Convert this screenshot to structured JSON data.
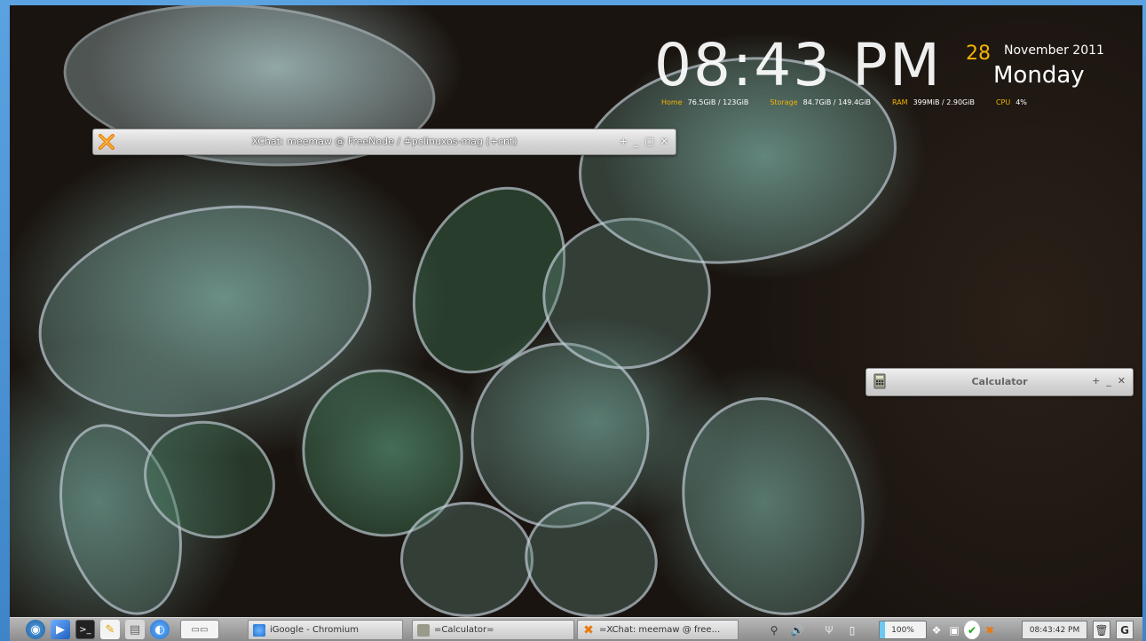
{
  "conky": {
    "time": "08:43 PM",
    "day": "28",
    "month_year": "November 2011",
    "weekday": "Monday",
    "stats": [
      {
        "label": "Home",
        "value": "76.5GiB / 123GiB"
      },
      {
        "label": "Storage",
        "value": "84.7GiB / 149.4GiB"
      },
      {
        "label": "RAM",
        "value": "399MiB / 2.90GiB"
      },
      {
        "label": "CPU",
        "value": "4%"
      }
    ]
  },
  "windows": {
    "xchat": {
      "title": "XChat: meemaw @ FreeNode / #pclinuxos-mag (+cnt)",
      "controls": [
        "+",
        "_",
        "□",
        "✕"
      ]
    },
    "calculator": {
      "title": "Calculator",
      "controls": [
        "+",
        "_",
        "✕"
      ]
    }
  },
  "taskbar": {
    "launchers": [
      "menu-icon",
      "desktop-icon",
      "terminal-icon",
      "text-editor-icon",
      "file-manager-icon",
      "web-browser-icon"
    ],
    "tasks": [
      {
        "label": "iGoogle - Chromium",
        "icon": "chromium-icon"
      },
      {
        "label": "=Calculator=",
        "icon": "calculator-icon"
      },
      {
        "label": "=XChat: meemaw @ free...",
        "icon": "xchat-icon"
      }
    ],
    "battery_label": "100%",
    "battery_level": 0.12,
    "clock": "08:43:42 PM"
  }
}
